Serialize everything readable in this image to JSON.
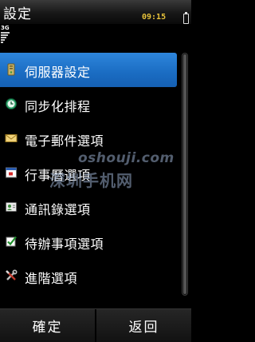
{
  "status": {
    "title": "設定",
    "time": "09:15",
    "network": "3G"
  },
  "menu": {
    "items": [
      {
        "label": "伺服器設定",
        "icon": "server-icon"
      },
      {
        "label": "同步化排程",
        "icon": "sync-clock-icon"
      },
      {
        "label": "電子郵件選項",
        "icon": "mail-envelope-icon"
      },
      {
        "label": "行事曆選項",
        "icon": "calendar-icon"
      },
      {
        "label": "通訊錄選項",
        "icon": "contacts-icon"
      },
      {
        "label": "待辦事項選項",
        "icon": "checkbox-icon"
      },
      {
        "label": "進階選項",
        "icon": "tools-icon"
      }
    ],
    "selected_index": 0
  },
  "watermark": {
    "url": "oshouji.com",
    "text": "深圳手机网"
  },
  "softkeys": {
    "left": "確定",
    "right": "返回"
  },
  "colors": {
    "selection": "#1a6cc2",
    "clock": "#e7c23a"
  }
}
